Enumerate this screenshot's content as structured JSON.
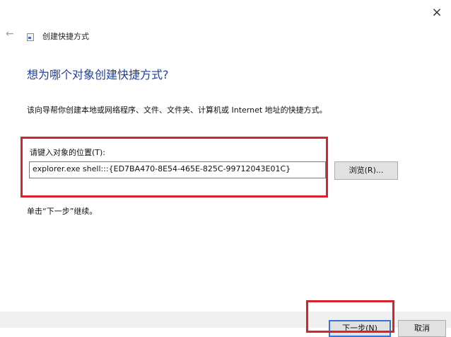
{
  "window": {
    "title": "创建快捷方式",
    "close_glyph": "×",
    "back_glyph": "←"
  },
  "main": {
    "heading": "想为哪个对象创建快捷方式?",
    "description": "该向导帮你创建本地或网络程序、文件、文件夹、计算机或 Internet 地址的快捷方式。",
    "location_label": "请键入对象的位置(T):",
    "location_value": "explorer.exe shell:::{ED7BA470-8E54-465E-825C-99712043E01C}",
    "browse_label": "浏览(R)...",
    "hint": "单击“下一步”继续。"
  },
  "footer": {
    "next_label": "下一步(N)",
    "cancel_label": "取消"
  },
  "colors": {
    "heading": "#1f3f99",
    "highlight": "#d9232c",
    "button_bg": "#e1e1e1",
    "focus_border": "#3376d6"
  }
}
